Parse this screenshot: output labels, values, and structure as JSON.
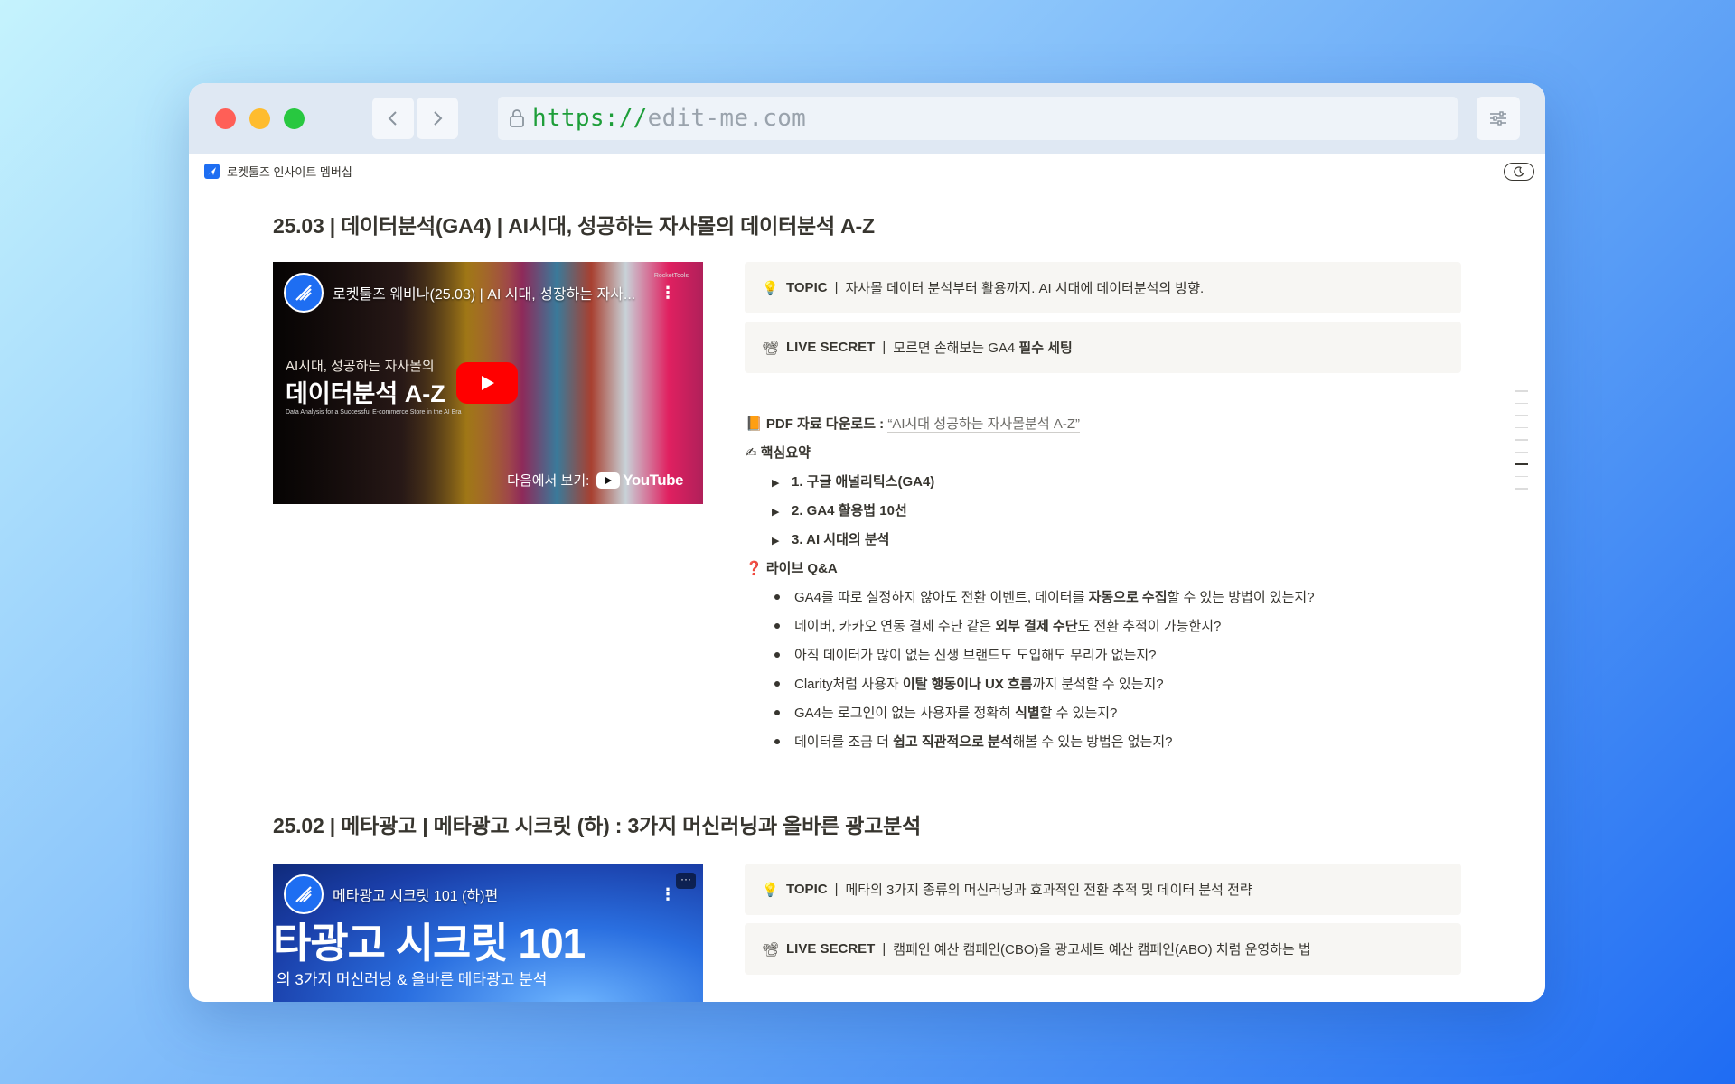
{
  "browser": {
    "url_scheme": "https://",
    "url_host": "edit-me.com"
  },
  "site": {
    "brand": "로켓툴즈 인사이트 멤버십"
  },
  "sections": [
    {
      "title": "25.03 | 데이터분석(GA4) | AI시대, 성공하는 자사몰의 데이터분석 A-Z",
      "video": {
        "title": "로켓툴즈 웨비나(25.03) | AI 시대, 성장하는 자사...",
        "brand_small": "RocketTools",
        "subtitle": "AI시대, 성공하는 자사몰의",
        "headline": "데이터분석 A-Z",
        "tagline": "Data Analysis for a Successful E-commerce Store in the AI Era",
        "watch_on": "다음에서 보기:",
        "youtube": "YouTube"
      },
      "topic": {
        "key": "TOPIC",
        "sep": "|",
        "text": "자사몰 데이터 분석부터 활용까지. AI 시대에 데이터분석의 방향."
      },
      "live_secret": {
        "key": "LIVE SECRET",
        "sep": "|",
        "text_pre": "모르면 손해보는 GA4 ",
        "text_bold": "필수 세팅"
      },
      "pdf": {
        "label": "PDF 자료 다운로드 :",
        "link": "“AI시대 성공하는 자사몰분석 A-Z”"
      },
      "summary_label": "핵심요약",
      "summary_items": [
        "1. 구글 애널리틱스(GA4)",
        "2. GA4 활용법 10선",
        "3. AI 시대의 분석"
      ],
      "qa_label": "라이브 Q&A",
      "qa_items": [
        {
          "pre": "GA4를 따로 설정하지 않아도 전환 이벤트, 데이터를 ",
          "bold": "자동으로 수집",
          "post": "할 수 있는 방법이 있는지?"
        },
        {
          "pre": "네이버, 카카오 연동 결제 수단 같은 ",
          "bold": "외부 결제 수단",
          "post": "도 전환 추적이 가능한지?"
        },
        {
          "pre": "아직 데이터가 많이 없는 신생 브랜드도 도입해도 무리가 없는지?",
          "bold": "",
          "post": ""
        },
        {
          "pre": "Clarity처럼 사용자 ",
          "bold": "이탈 행동이나 UX 흐름",
          "post": "까지 분석할 수 있는지?"
        },
        {
          "pre": "GA4는 로그인이 없는 사용자를 정확히 ",
          "bold": "식별",
          "post": "할 수 있는지?"
        },
        {
          "pre": "데이터를 조금 더 ",
          "bold": "쉽고 직관적으로 분석",
          "post": "해볼 수 있는 방법은 없는지?"
        }
      ]
    },
    {
      "title": "25.02 | 메타광고 | 메타광고 시크릿 (하) : 3가지 머신러닝과 올바른 광고분석",
      "video": {
        "title": "메타광고 시크릿 101 (하)편",
        "headline": "타광고 시크릿 101",
        "subtitle": "의 3가지 머신러닝 & 올바른 메타광고 분석",
        "menu": "···"
      },
      "topic": {
        "key": "TOPIC",
        "sep": "|",
        "text": "메타의 3가지 종류의 머신러닝과 효과적인 전환 추적 및 데이터 분석 전략"
      },
      "live_secret": {
        "key": "LIVE SECRET",
        "sep": "|",
        "text": "캠페인 예산 캠페인(CBO)을 광고세트 예산 캠페인(ABO) 처럼 운영하는 법"
      }
    }
  ],
  "icons": {
    "topic": "💡",
    "live": "📽",
    "pdf": "📙",
    "summary": "✍",
    "qa": "❓"
  }
}
